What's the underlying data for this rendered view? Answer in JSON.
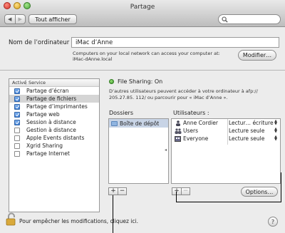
{
  "window": {
    "title": "Partage"
  },
  "toolbar": {
    "back_glyph": "◀",
    "forward_glyph": "▶",
    "show_all_label": "Tout afficher",
    "search_value": "",
    "search_icon": "search-icon"
  },
  "computer_name": {
    "label": "Nom de l’ordinateur :",
    "value": "iMac d’Anne",
    "description": "Computers on your local network can access your computer at: iMac-dAnne.local",
    "modify_label": "Modifier…"
  },
  "services": {
    "header_active": "Activé",
    "header_service": "Service",
    "items": [
      {
        "name": "Partage d’écran",
        "active": true,
        "selected": false
      },
      {
        "name": "Partage de fichiers",
        "active": true,
        "selected": true
      },
      {
        "name": "Partage d’imprimantes",
        "active": true,
        "selected": false
      },
      {
        "name": "Partage web",
        "active": true,
        "selected": false
      },
      {
        "name": "Session à distance",
        "active": true,
        "selected": false
      },
      {
        "name": "Gestion à distance",
        "active": false,
        "selected": false
      },
      {
        "name": "Apple Events distants",
        "active": false,
        "selected": false
      },
      {
        "name": "Xgrid Sharing",
        "active": false,
        "selected": false
      },
      {
        "name": "Partage Internet",
        "active": false,
        "selected": false
      }
    ]
  },
  "status": {
    "text": "File Sharing: On",
    "status_color": "#3c9a2a",
    "description": "D’autres utilisateurs peuvent accéder à votre ordinateur à afp:// 205.27.85. 112/ ou parcourir pour « iMac d’Anne »."
  },
  "folders": {
    "label": "Dossiers",
    "items": [
      {
        "name": "Boîte de dépôt",
        "icon": "folder-icon"
      }
    ],
    "add": "+",
    "remove": "−"
  },
  "users": {
    "label": "Utilisateurs :",
    "items": [
      {
        "name": "Anne Cordier",
        "permission": "Lectur… écriture",
        "icon": "person-icon"
      },
      {
        "name": "Users",
        "permission": "Lecture seule",
        "icon": "group-icon"
      },
      {
        "name": "Everyone",
        "permission": "Lecture seule",
        "icon": "everyone-icon"
      }
    ],
    "add": "+",
    "remove": "−",
    "options_label": "Options…"
  },
  "footer": {
    "lock_text": "Pour empêcher les modifications, cliquez ici.",
    "help_label": "?"
  },
  "colors": {
    "accent": "#3d7fd6",
    "selection": "#c8d4e6"
  }
}
